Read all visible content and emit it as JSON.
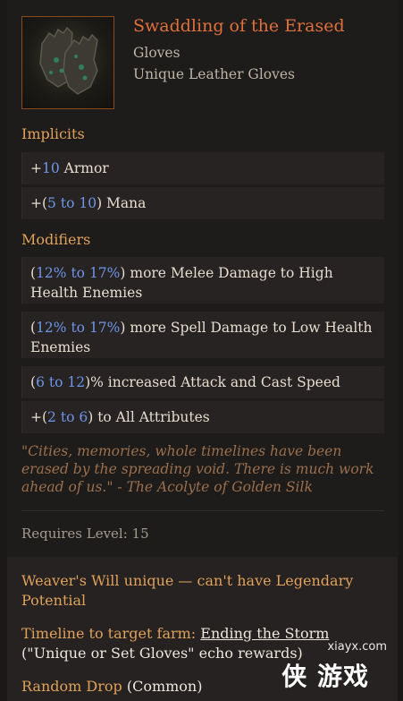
{
  "item": {
    "name": "Swaddling of the Erased",
    "type": "Gloves",
    "subtype": "Unique Leather Gloves",
    "icon": "gloves-icon"
  },
  "implicits": {
    "title": "Implicits",
    "rows": [
      {
        "prefix": "+",
        "num1": "10",
        "mid": "",
        "num2": "",
        "suffix": " Armor"
      },
      {
        "prefix": "+(",
        "num1": "5",
        "mid": " to ",
        "num2": "10",
        "suffix": ") Mana"
      }
    ]
  },
  "modifiers": {
    "title": "Modifiers",
    "rows": [
      {
        "prefix": "(",
        "num1": "12%",
        "mid": " to ",
        "num2": "17%",
        "suffix": ") more Melee Damage to High Health Enemies"
      },
      {
        "prefix": "(",
        "num1": "12%",
        "mid": " to ",
        "num2": "17%",
        "suffix": ") more Spell Damage to Low Health Enemies"
      },
      {
        "prefix": "(",
        "num1": "6",
        "mid": " to ",
        "num2": "12",
        "suffix": ")% increased Attack and Cast Speed"
      },
      {
        "prefix": "+(",
        "num1": "2",
        "mid": " to ",
        "num2": "6",
        "suffix": ") to All Attributes"
      }
    ]
  },
  "lore": "\"Cities, memories, whole timelines have been erased by the spreading void. There is much work ahead of us.\" - The Acolyte of Golden Silk",
  "requirement": "Requires Level: 15",
  "footer": {
    "note": "Weaver's Will unique — can't have Legendary Potential",
    "farm_prefix": "Timeline to target farm: ",
    "farm_link": "Ending the Storm",
    "farm_suffix": " (\"Unique or Set Gloves\" echo rewards)",
    "drop_label": "Random Drop",
    "drop_rarity": " (Common)"
  },
  "watermark": {
    "site": "xiayx.com",
    "text": "侠 游戏"
  },
  "colors": {
    "name": "#e0703a",
    "section": "#e0a15a",
    "number": "#6f95e8",
    "lore": "#9b6f4c"
  }
}
